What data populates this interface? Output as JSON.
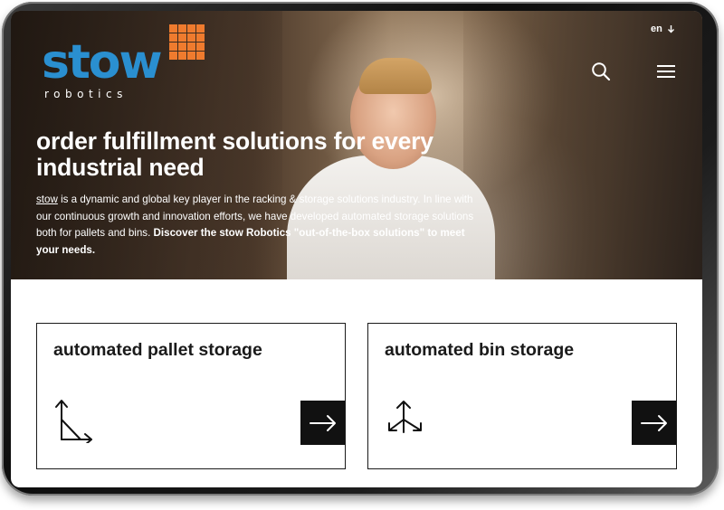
{
  "brand": {
    "logo_text": "stow",
    "logo_subtext": "robotics",
    "logo_accent_color": "#ef7b2e",
    "logo_text_color": "#2a8fd0"
  },
  "header": {
    "language": "en",
    "language_icon": "chevron-down-icon",
    "search_icon": "search-icon",
    "menu_icon": "hamburger-menu-icon"
  },
  "hero": {
    "headline": "order fulfillment solutions for every industrial need",
    "intro_brand": "stow",
    "intro_text": " is a dynamic and global key player in the racking & storage solutions industry. In line with our continuous growth and innovation efforts, we have developed automated storage solutions both for pallets and bins. ",
    "intro_bold": "Discover the stow Robotics \"out-of-the-box solutions\" to meet your needs."
  },
  "cards": [
    {
      "title": "automated pallet storage",
      "icon": "axis-arrows-icon",
      "arrow_icon": "arrow-right-icon"
    },
    {
      "title": "automated bin storage",
      "icon": "multi-direction-arrows-icon",
      "arrow_icon": "arrow-right-icon"
    }
  ]
}
